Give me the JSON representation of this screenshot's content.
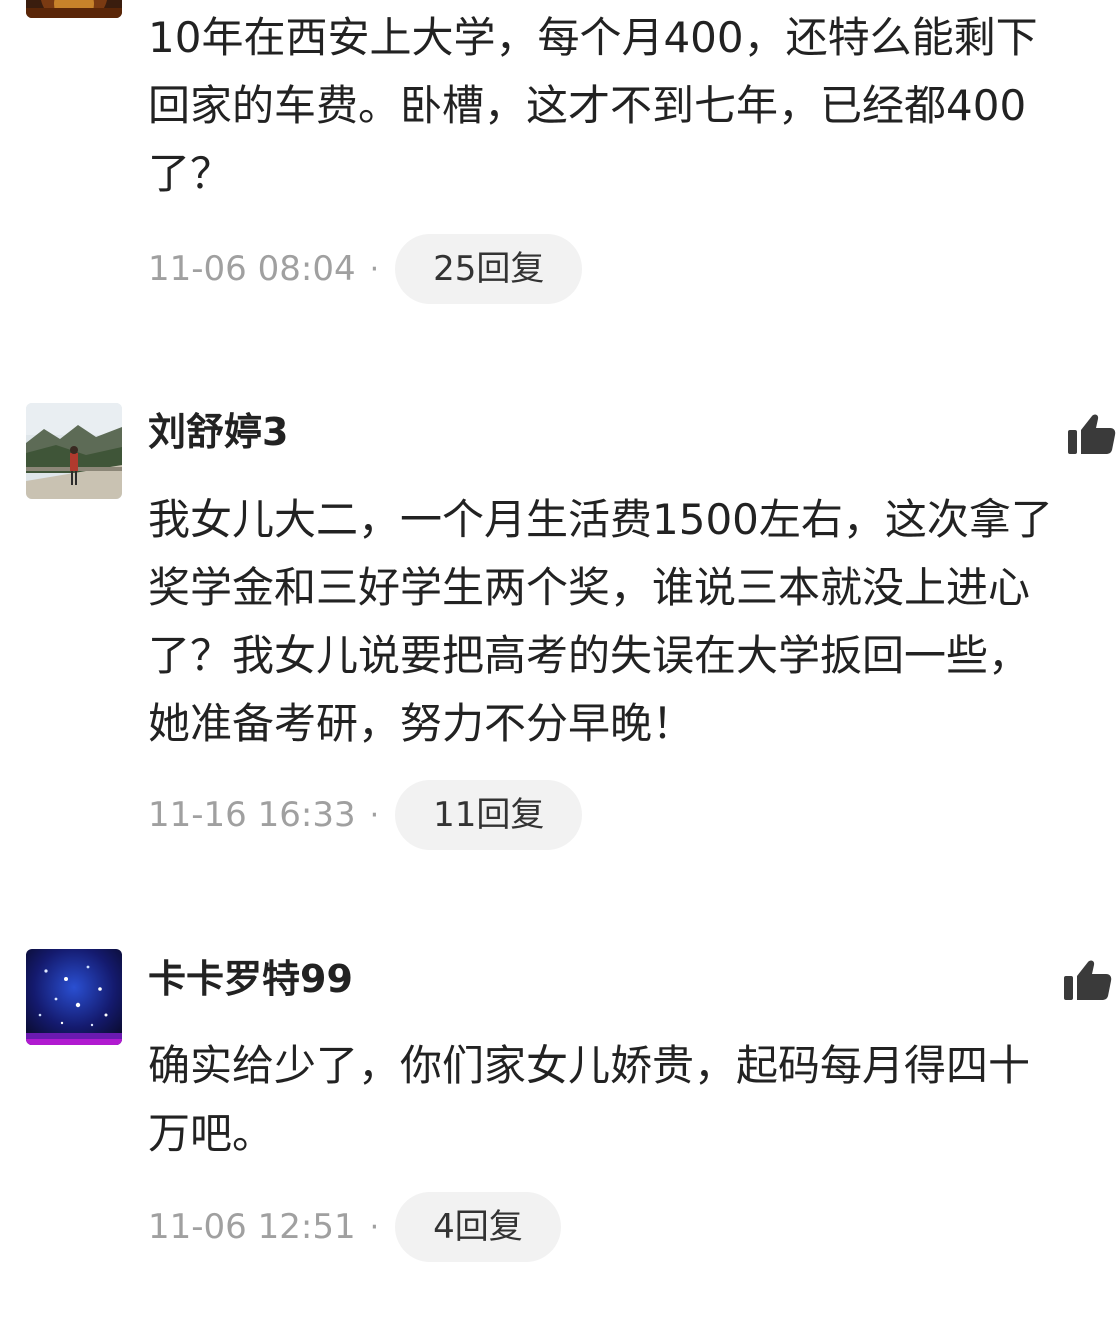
{
  "comments": [
    {
      "username": "",
      "avatar": "portrait-avatar",
      "text": "10年在西安上大学，每个月400，还特么能剩下\n回家的车费。卧槽，这才不到七年，已经都400\n了？",
      "timestamp": "11-06 08:04",
      "separator": "·",
      "reply_label": "25回复"
    },
    {
      "username": "刘舒婷3",
      "avatar": "landscape-avatar",
      "text": "我女儿大二，一个月生活费1500左右，这次拿了\n奖学金和三好学生两个奖，谁说三本就没上进心\n了？我女儿说要把高考的失误在大学扳回一些，\n她准备考研，努力不分早晚！",
      "timestamp": "11-16 16:33",
      "separator": "·",
      "reply_label": "11回复"
    },
    {
      "username": "卡卡罗特99",
      "avatar": "starry-sky-avatar",
      "text": "确实给少了，你们家女儿娇贵，起码每月得四十\n万吧。",
      "timestamp": "11-06 12:51",
      "separator": "·",
      "reply_label": "4回复"
    }
  ],
  "icons": {
    "like": "thumbs-up-icon"
  },
  "colors": {
    "text": "#222222",
    "timestamp": "#a0a0a0",
    "reply_pill": "#f2f2f2",
    "like_icon": "#3a3a3a"
  }
}
